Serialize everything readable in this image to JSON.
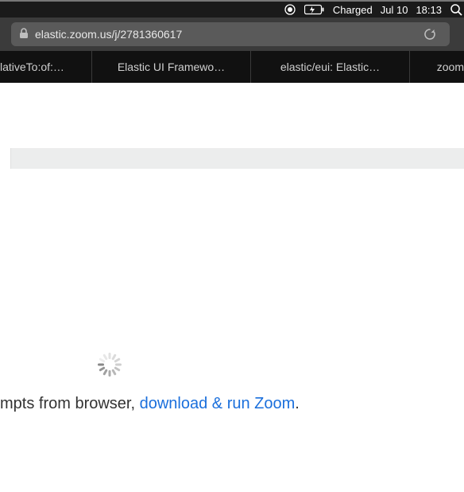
{
  "menubar": {
    "battery_status": "Charged",
    "date": "Jul 10",
    "time": "18:13"
  },
  "address_bar": {
    "url": "elastic.zoom.us/j/2781360617"
  },
  "bookmarks": {
    "items": [
      {
        "label": "lativeTo:of:…"
      },
      {
        "label": "Elastic UI Framewo…"
      },
      {
        "label": "elastic/eui: Elastic…"
      },
      {
        "label": "zoom"
      }
    ]
  },
  "page": {
    "prompt_prefix": "mpts from browser, ",
    "download_link": "download & run Zoom",
    "prompt_suffix": "."
  }
}
